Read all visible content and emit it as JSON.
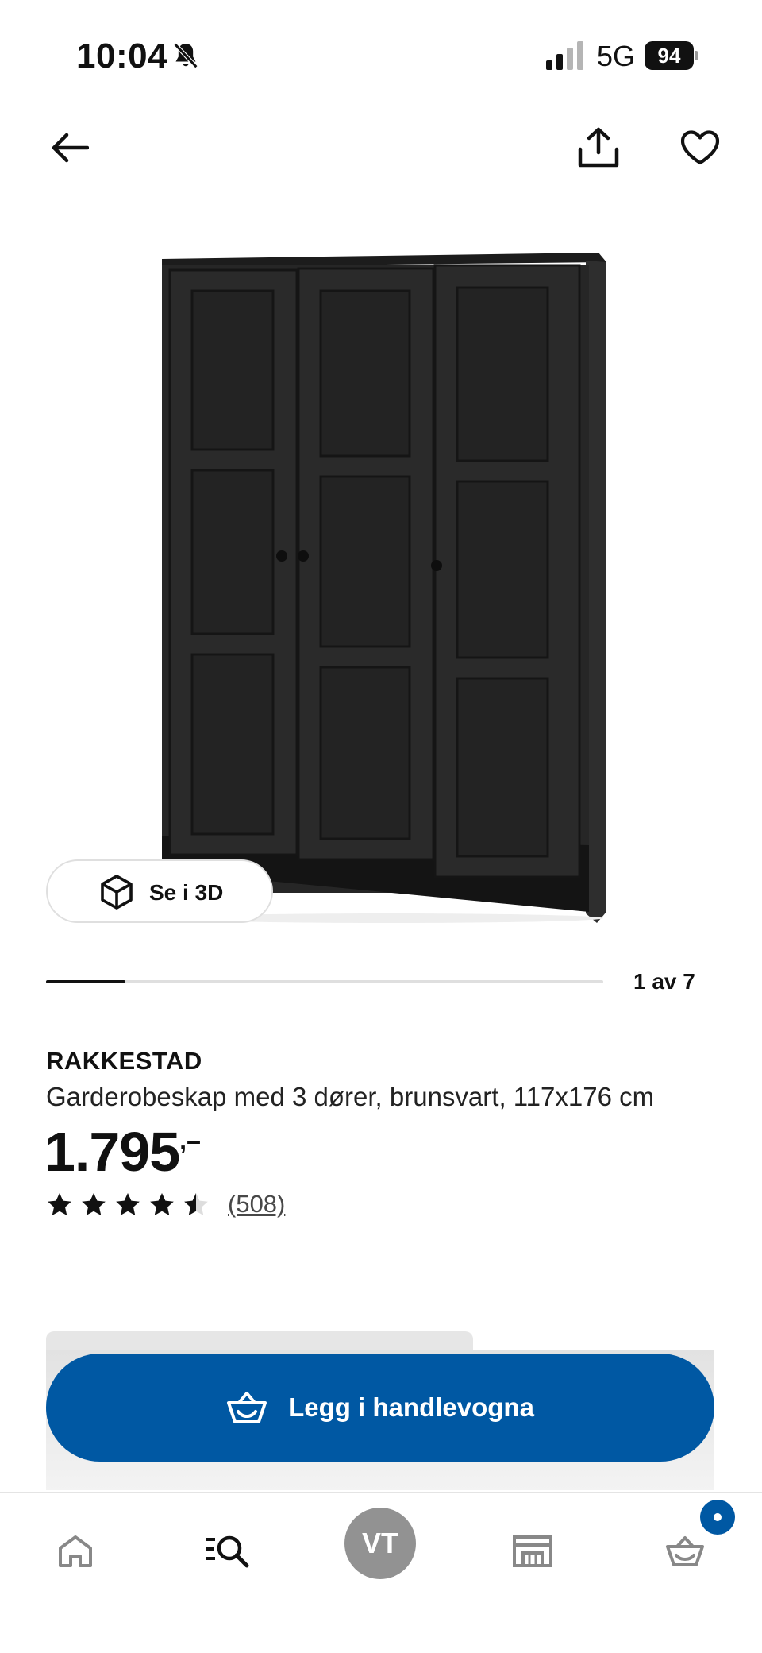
{
  "status_bar": {
    "time": "10:04",
    "network": "5G",
    "battery": "94"
  },
  "icons": {
    "back": "arrow-left-icon",
    "share": "share-icon",
    "favorite": "heart-icon",
    "view3d": "cube-icon",
    "cart_button": "basket-icon",
    "tabs": [
      "home-icon",
      "search-icon",
      "avatar",
      "store-icon",
      "cart-icon"
    ]
  },
  "gallery": {
    "view_3d_label": "Se i 3D",
    "pager_text": "1 av 7",
    "current_index": 1,
    "total": 7
  },
  "product": {
    "name": "RAKKESTAD",
    "description": "Garderobeskap med 3 dører, brunsvart, 117x176 cm",
    "price": "1.795",
    "price_suffix": ",–",
    "rating": 4.5,
    "rating_max": 5,
    "review_count": "(508)"
  },
  "cart": {
    "add_label": "Legg i handlevogna"
  },
  "tab_bar": {
    "profile_initials": "VT"
  },
  "colors": {
    "ikea_blue": "#0058a3",
    "text": "#111111",
    "avatar_gray": "#929292"
  }
}
